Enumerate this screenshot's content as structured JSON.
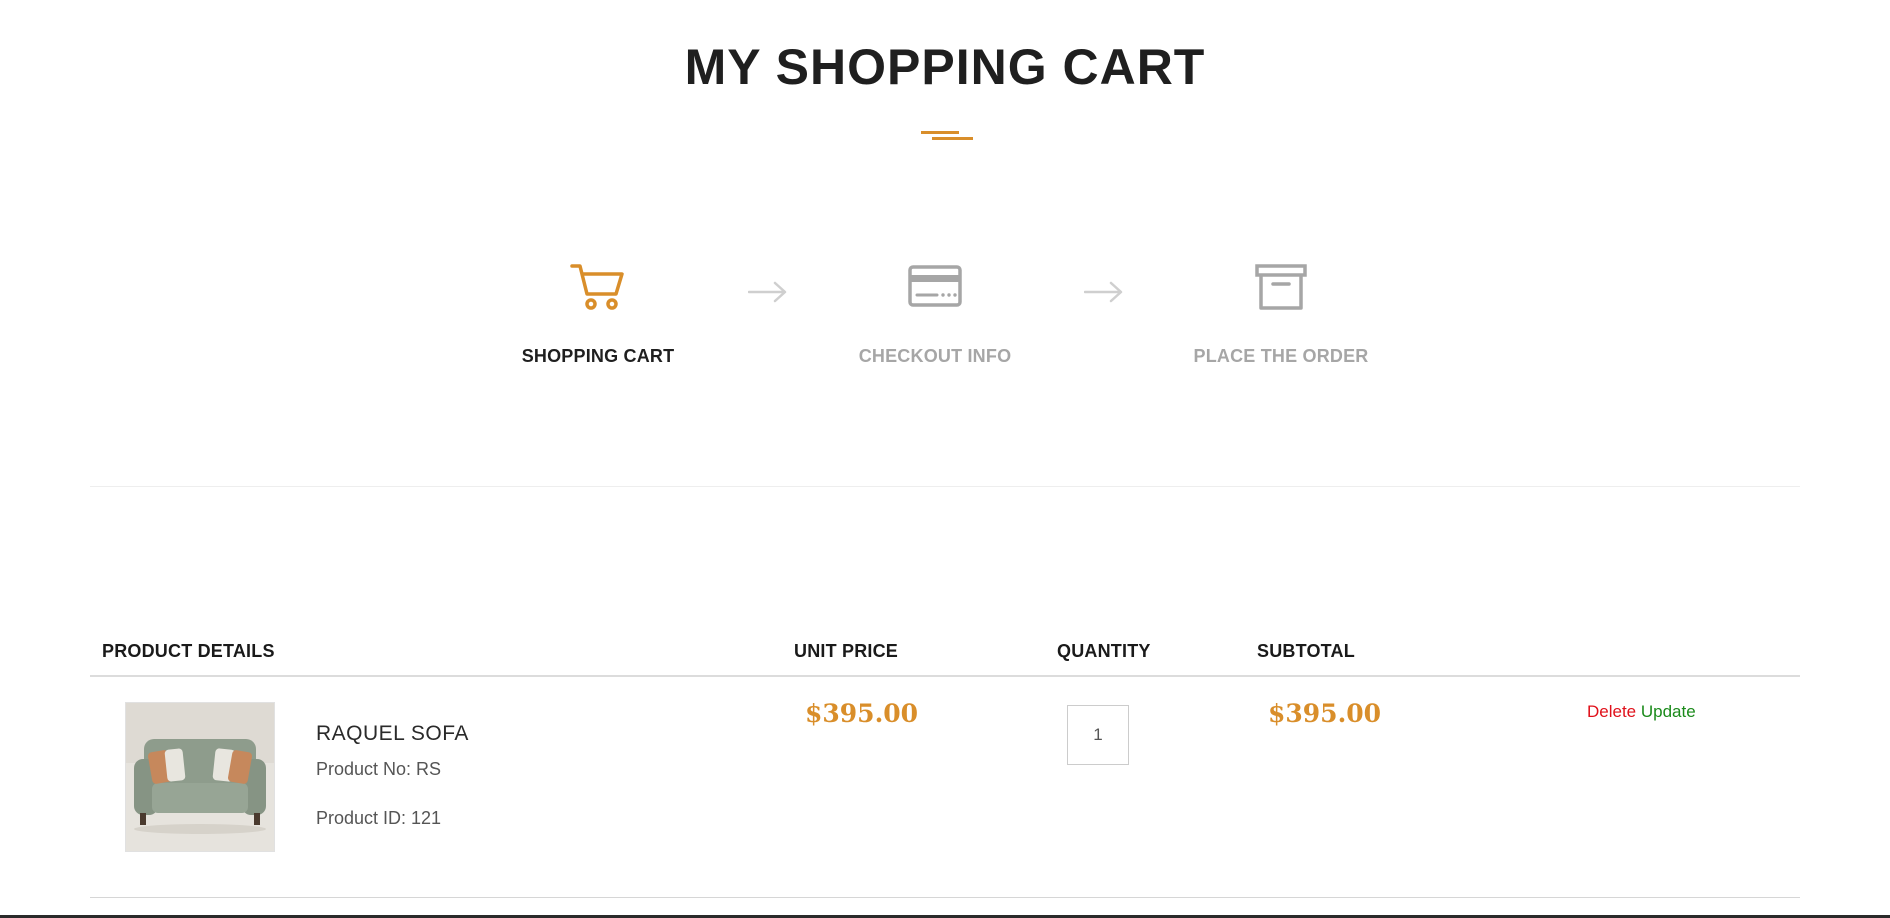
{
  "page": {
    "title": "MY SHOPPING CART"
  },
  "steps": [
    {
      "label": "SHOPPING CART",
      "icon": "cart-icon",
      "state": "active"
    },
    {
      "label": "CHECKOUT INFO",
      "icon": "credit-card-icon",
      "state": "inactive"
    },
    {
      "label": "PLACE THE ORDER",
      "icon": "archive-box-icon",
      "state": "inactive"
    }
  ],
  "table": {
    "headers": {
      "product_details": "PRODUCT DETAILS",
      "unit_price": "UNIT PRICE",
      "quantity": "QUANTITY",
      "subtotal": "SUBTOTAL"
    },
    "rows": [
      {
        "name": "RAQUEL SOFA",
        "product_no": "Product No: RS",
        "product_id": "Product ID: 121",
        "unit_price": "$395.00",
        "quantity": "1",
        "subtotal": "$395.00",
        "delete_label": "Delete",
        "update_label": "Update"
      }
    ]
  },
  "colors": {
    "accent": "#d98e2a",
    "inactive": "#a6a6a6",
    "delete": "#e0101a",
    "update": "#1a8a1a"
  }
}
